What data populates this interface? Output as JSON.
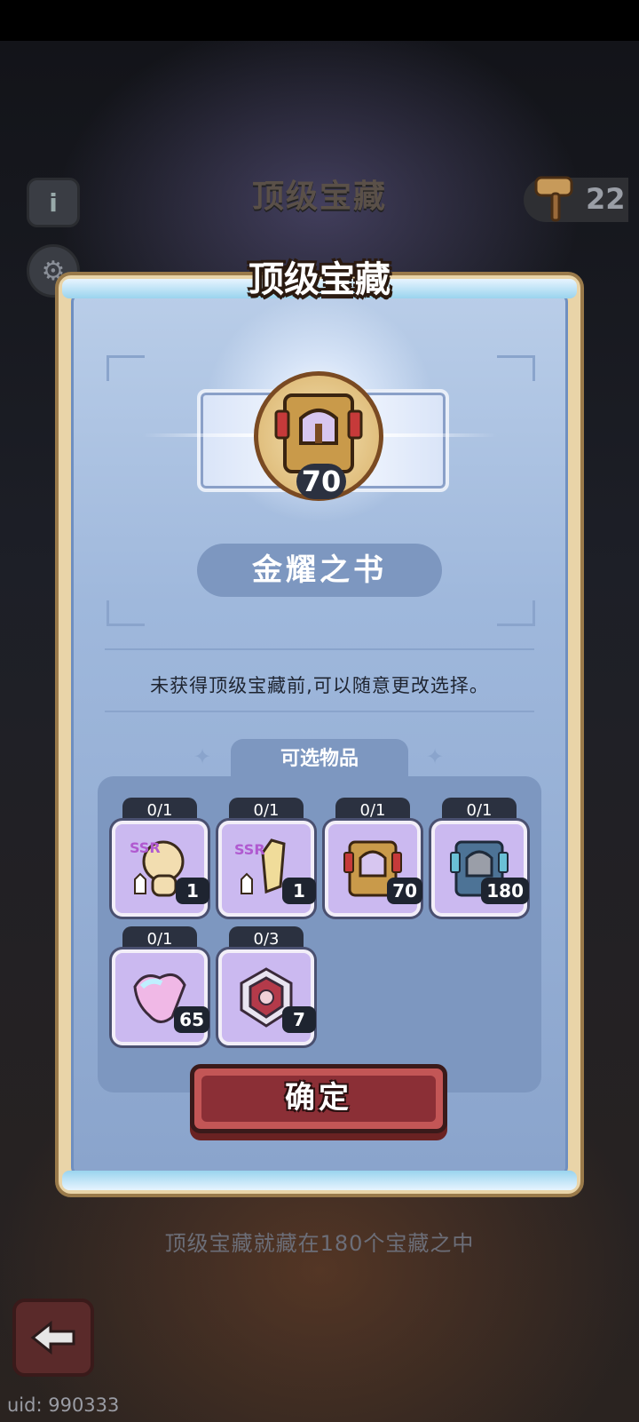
{
  "background": {
    "title": "顶级宝藏",
    "hammer_count": "22",
    "footer_text": "顶级宝藏就藏在180个宝藏之中",
    "uid": "uid: 990333"
  },
  "modal": {
    "title": "顶级宝藏",
    "selected": {
      "name": "金耀之书",
      "count": "70"
    },
    "hint": "未获得顶级宝藏前,可以随意更改选择。",
    "tab_label": "可选物品",
    "confirm_label": "确定"
  },
  "items": [
    {
      "progress": "0/1",
      "qty": "1",
      "icon": "ssr-head-icon"
    },
    {
      "progress": "0/1",
      "qty": "1",
      "icon": "ssr-weapon-icon"
    },
    {
      "progress": "0/1",
      "qty": "70",
      "icon": "gold-book-icon"
    },
    {
      "progress": "0/1",
      "qty": "180",
      "icon": "blue-book-icon"
    },
    {
      "progress": "0/1",
      "qty": "65",
      "icon": "pink-crystal-icon"
    },
    {
      "progress": "0/3",
      "qty": "7",
      "icon": "red-emblem-icon"
    }
  ],
  "colors": {
    "panel": "#9fb8dc",
    "accent": "#7d97c0",
    "confirm": "#8b2f36"
  }
}
